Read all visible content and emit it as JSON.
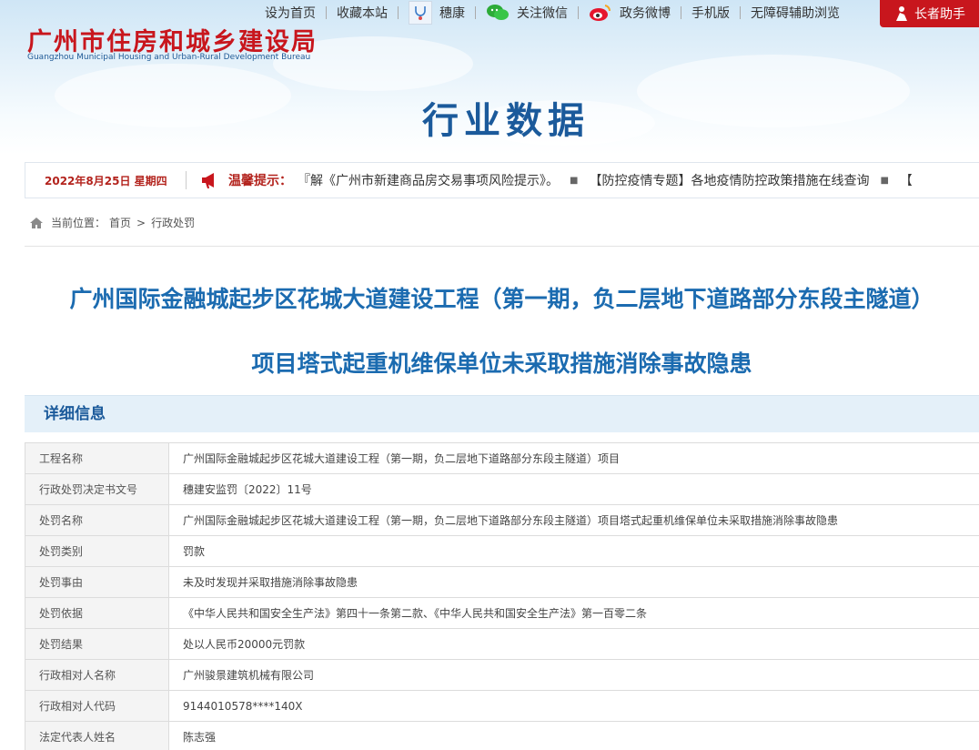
{
  "header": {
    "org_name_cn": "广州市住房和城乡建设局",
    "org_name_en": "Guangzhou Municipal Housing and Urban-Rural Development Bureau",
    "nav": [
      {
        "label": "设为首页",
        "icon": ""
      },
      {
        "label": "收藏本站",
        "icon": ""
      },
      {
        "label": "穗康",
        "icon": "stethoscope-icon"
      },
      {
        "label": "关注微信",
        "icon": "wechat-icon"
      },
      {
        "label": "政务微博",
        "icon": "weibo-icon"
      },
      {
        "label": "手机版",
        "icon": ""
      },
      {
        "label": "无障碍辅助浏览",
        "icon": ""
      }
    ],
    "elder_button": "长者助手",
    "section_title": "行业数据"
  },
  "notice": {
    "date": "2022年8月25日 星期四",
    "tip_label": "温馨提示：",
    "items": [
      "『解《广州市新建商品房交易事项风险提示》。",
      "【防控疫情专题】各地疫情防控政策措施在线查询",
      "【"
    ]
  },
  "breadcrumb": {
    "prefix": "当前位置：",
    "home": "首页",
    "separator": ">",
    "current": "行政处罚"
  },
  "article": {
    "title_line1": "广州国际金融城起步区花城大道建设工程（第一期，负二层地下道路部分东段主隧道）",
    "title_line2": "项目塔式起重机维保单位未采取措施消除事故隐患"
  },
  "detail": {
    "heading": "详细信息",
    "rows": [
      {
        "key": "工程名称",
        "value": "广州国际金融城起步区花城大道建设工程（第一期，负二层地下道路部分东段主隧道）项目"
      },
      {
        "key": "行政处罚决定书文号",
        "value": "穗建安监罚〔2022〕11号"
      },
      {
        "key": "处罚名称",
        "value": "广州国际金融城起步区花城大道建设工程（第一期，负二层地下道路部分东段主隧道）项目塔式起重机维保单位未采取措施消除事故隐患"
      },
      {
        "key": "处罚类别",
        "value": "罚款"
      },
      {
        "key": "处罚事由",
        "value": "未及时发现并采取措施消除事故隐患"
      },
      {
        "key": "处罚依据",
        "value": "《中华人民共和国安全生产法》第四十一条第二款、《中华人民共和国安全生产法》第一百零二条"
      },
      {
        "key": "处罚结果",
        "value": "处以人民币20000元罚款"
      },
      {
        "key": "行政相对人名称",
        "value": "广州骏景建筑机械有限公司"
      },
      {
        "key": "行政相对人代码",
        "value": "9144010578****140X"
      },
      {
        "key": "法定代表人姓名",
        "value": "陈志强"
      }
    ]
  },
  "colors": {
    "brand_red": "#c8161d",
    "title_blue": "#1b5a9b",
    "heading_bg": "#e4f0f9"
  }
}
